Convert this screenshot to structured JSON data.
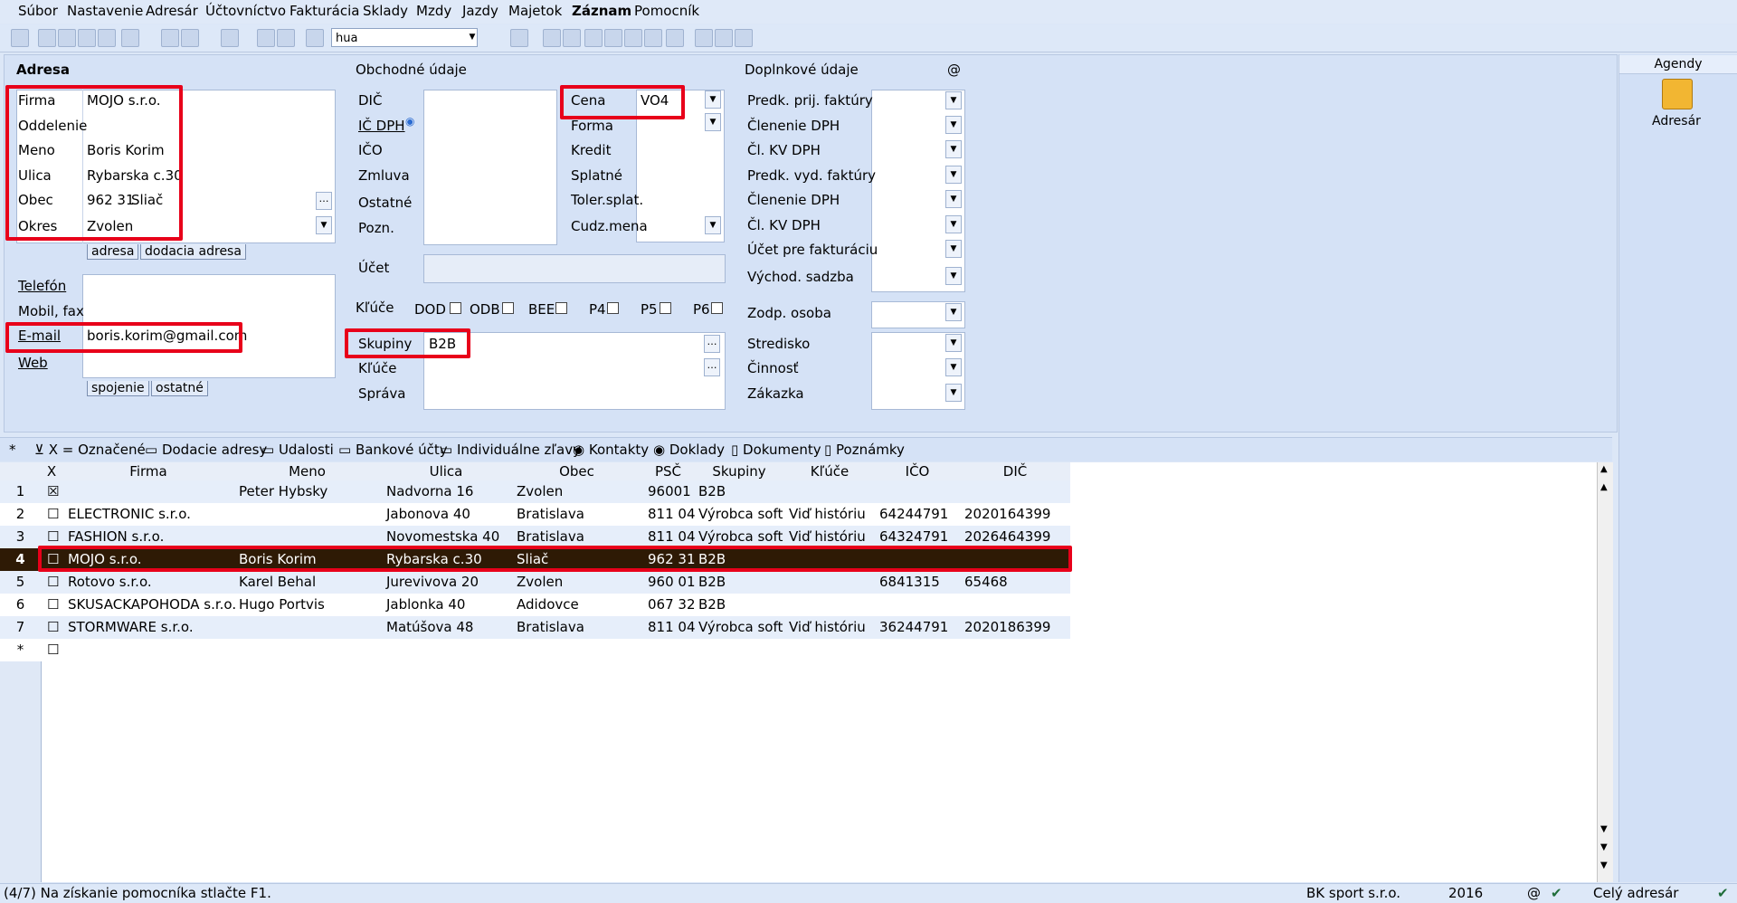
{
  "menu": [
    "Súbor",
    "Nastavenie",
    "Adresár",
    "Účtovníctvo",
    "Fakturácia",
    "Sklady",
    "Mzdy",
    "Jazdy",
    "Majetok",
    "Záznam",
    "Pomocník"
  ],
  "toolbar": {
    "search_value": "hua"
  },
  "address": {
    "header": "Adresa",
    "labels": {
      "firma": "Firma",
      "oddelenie": "Oddelenie",
      "meno": "Meno",
      "ulica": "Ulica",
      "obec": "Obec",
      "okres": "Okres"
    },
    "values": {
      "firma": "MOJO s.r.o.",
      "oddelenie": "",
      "meno": "Boris Korim",
      "ulica": "Rybarska c.30",
      "psc": "962 31",
      "obec": "Sliač",
      "okres": "Zvolen"
    },
    "tabs": [
      "adresa",
      "dodacia adresa"
    ]
  },
  "contact": {
    "labels": {
      "telefon": "Telefón",
      "mobil": "Mobil, fax",
      "email": "E-mail",
      "web": "Web"
    },
    "values": {
      "email": "boris.korim@gmail.com"
    },
    "tabs": [
      "spojenie",
      "ostatné"
    ]
  },
  "business": {
    "header": "Obchodné údaje",
    "labels": {
      "dic": "DIČ",
      "icdph": "IČ DPH",
      "ico": "IČO",
      "zmluva": "Zmluva",
      "ostatne": "Ostatné",
      "pozn": "Pozn.",
      "ucet": "Účet",
      "kluce": "Kľúče"
    },
    "price_labels": {
      "cena": "Cena",
      "forma": "Forma",
      "kredit": "Kredit",
      "splatne": "Splatné",
      "toler": "Toler.splat.",
      "cudz": "Cudz.mena"
    },
    "cena_value": "VO4",
    "keys": [
      "DOD",
      "ODB",
      "BEE",
      "P4",
      "P5",
      "P6"
    ],
    "skupiny_label": "Skupiny",
    "skupiny_value": "B2B",
    "kluce2_label": "Kľúče",
    "sprava_label": "Správa"
  },
  "extra": {
    "header": "Doplnkové údaje",
    "at": "@",
    "labels": [
      "Predk. prij. faktúry",
      "Členenie DPH",
      "Čl. KV DPH",
      "Predk. vyd. faktúry",
      "Členenie DPH",
      "Čl. KV DPH",
      "Účet pre fakturáciu",
      "Východ. sadzba"
    ],
    "zodp": "Zodp. osoba",
    "lower": [
      "Stredisko",
      "Činnosť",
      "Zákazka"
    ]
  },
  "side": {
    "header": "Agendy",
    "item": "Adresár"
  },
  "gridtabs": [
    "*",
    "X = Označené",
    "Dodacie adresy",
    "Udalosti",
    "Bankové účty",
    "Individuálne zľavy",
    "Kontakty",
    "Doklady",
    "Dokumenty",
    "Poznámky"
  ],
  "grid": {
    "columns": [
      "X",
      "Firma",
      "Meno",
      "Ulica",
      "Obec",
      "PSČ",
      "Skupiny",
      "Kľúče",
      "IČO",
      "DIČ"
    ],
    "rows": [
      {
        "n": "1",
        "x": "☒",
        "firma": "",
        "meno": "Peter Hybsky",
        "ulica": "Nadvorna 16",
        "obec": "Zvolen",
        "psc": "96001",
        "skup": "B2B",
        "kluce": "",
        "ico": "",
        "dic": ""
      },
      {
        "n": "2",
        "x": "☐",
        "firma": "ELECTRONIC s.r.o.",
        "meno": "",
        "ulica": "Jabonova 40",
        "obec": "Bratislava",
        "psc": "811 04",
        "skup": "Výrobca soft",
        "kluce": "Viď históriu",
        "ico": "64244791",
        "dic": "2020164399"
      },
      {
        "n": "3",
        "x": "☐",
        "firma": "FASHION s.r.o.",
        "meno": "",
        "ulica": "Novomestska 40",
        "obec": "Bratislava",
        "psc": "811 04",
        "skup": "Výrobca soft",
        "kluce": "Viď históriu",
        "ico": "64324791",
        "dic": "2026464399"
      },
      {
        "n": "4",
        "x": "☐",
        "firma": "MOJO s.r.o.",
        "meno": "Boris Korim",
        "ulica": "Rybarska c.30",
        "obec": "Sliač",
        "psc": "962 31",
        "skup": "B2B",
        "kluce": "",
        "ico": "",
        "dic": ""
      },
      {
        "n": "5",
        "x": "☐",
        "firma": "Rotovo s.r.o.",
        "meno": "Karel Behal",
        "ulica": "Jurevivova 20",
        "obec": "Zvolen",
        "psc": "960 01",
        "skup": "B2B",
        "kluce": "",
        "ico": "6841315",
        "dic": "65468"
      },
      {
        "n": "6",
        "x": "☐",
        "firma": "SKUSACKAPOHODA s.r.o.",
        "meno": "Hugo Portvis",
        "ulica": "Jablonka 40",
        "obec": "Adidovce",
        "psc": "067 32",
        "skup": "B2B",
        "kluce": "",
        "ico": "",
        "dic": ""
      },
      {
        "n": "7",
        "x": "☐",
        "firma": "STORMWARE s.r.o.",
        "meno": "",
        "ulica": "Matúšova 48",
        "obec": "Bratislava",
        "psc": "811 04",
        "skup": "Výrobca soft",
        "kluce": "Viď históriu",
        "ico": "36244791",
        "dic": "2020186399"
      },
      {
        "n": "*",
        "x": "☐",
        "firma": "",
        "meno": "",
        "ulica": "",
        "obec": "",
        "psc": "",
        "skup": "",
        "kluce": "",
        "ico": "",
        "dic": ""
      }
    ]
  },
  "status": {
    "left": "(4/7) Na získanie pomocníka stlačte F1.",
    "company": "BK sport  s.r.o.",
    "year": "2016",
    "at": "@",
    "scope": "Celý adresár"
  }
}
